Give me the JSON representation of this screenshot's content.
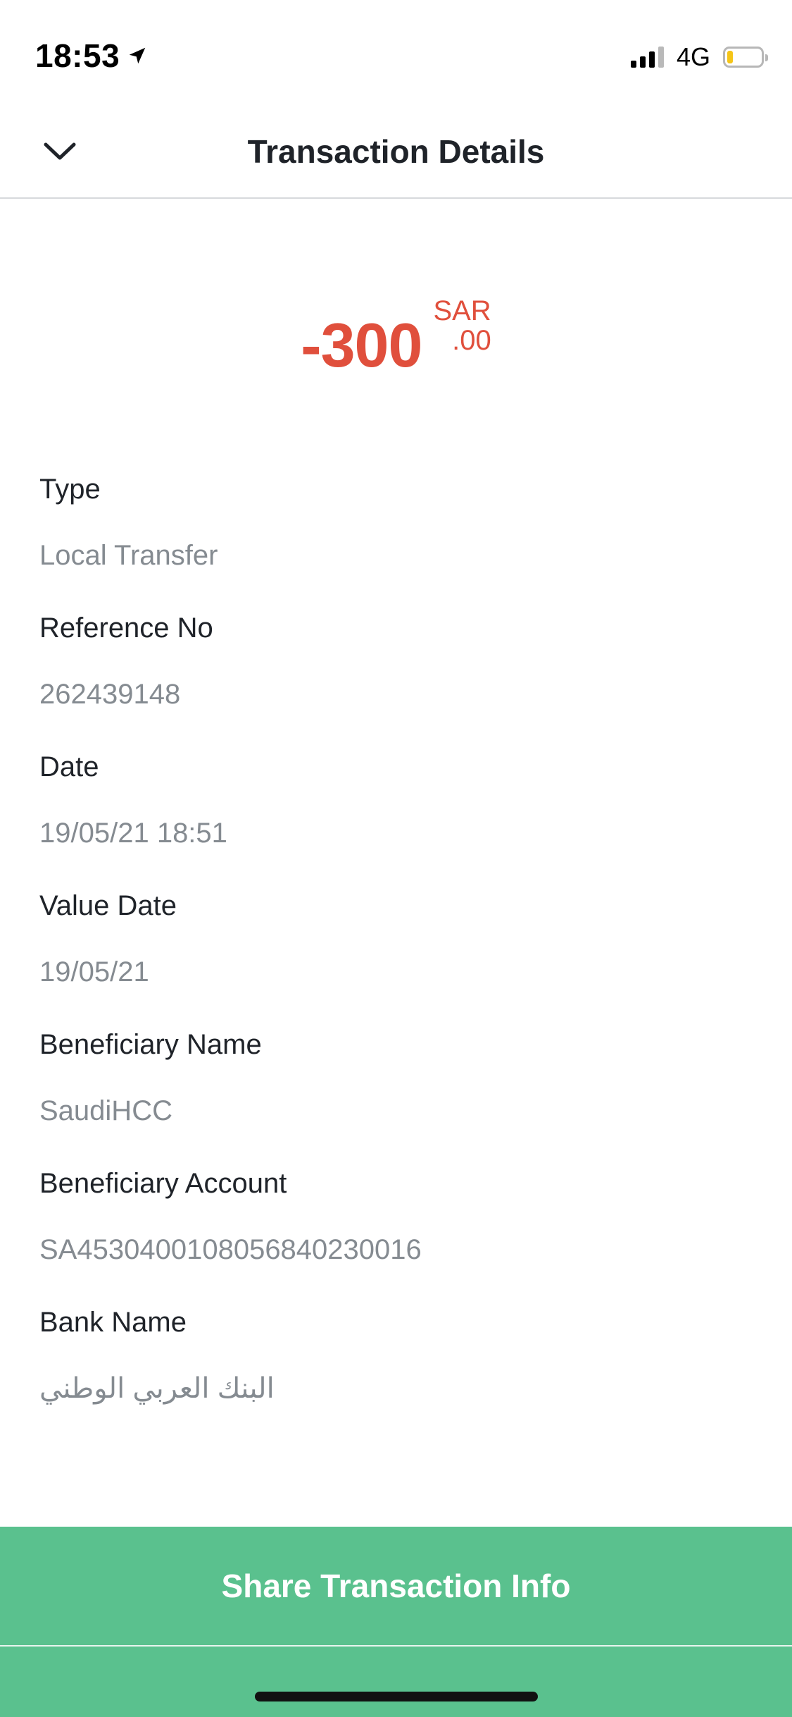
{
  "status_bar": {
    "time": "18:53",
    "network": "4G",
    "battery_color": "#f5c518"
  },
  "header": {
    "title": "Transaction Details",
    "back_icon": "chevron-down-icon"
  },
  "amount": {
    "value": "-300",
    "currency": "SAR",
    "decimal": ".00",
    "color": "#e04f3c"
  },
  "details": [
    {
      "label": "Type",
      "value": "Local Transfer"
    },
    {
      "label": "Reference No",
      "value": "262439148"
    },
    {
      "label": "Date",
      "value": "19/05/21 18:51"
    },
    {
      "label": "Value Date",
      "value": "19/05/21"
    },
    {
      "label": "Beneficiary Name",
      "value": "SaudiHCC"
    },
    {
      "label": "Beneficiary Account",
      "value": "SA4530400108056840230016"
    },
    {
      "label": "Bank Name",
      "value": "البنك العربي الوطني"
    }
  ],
  "actions": {
    "share_label": "Share Transaction Info",
    "button_color": "#5ac18e"
  }
}
